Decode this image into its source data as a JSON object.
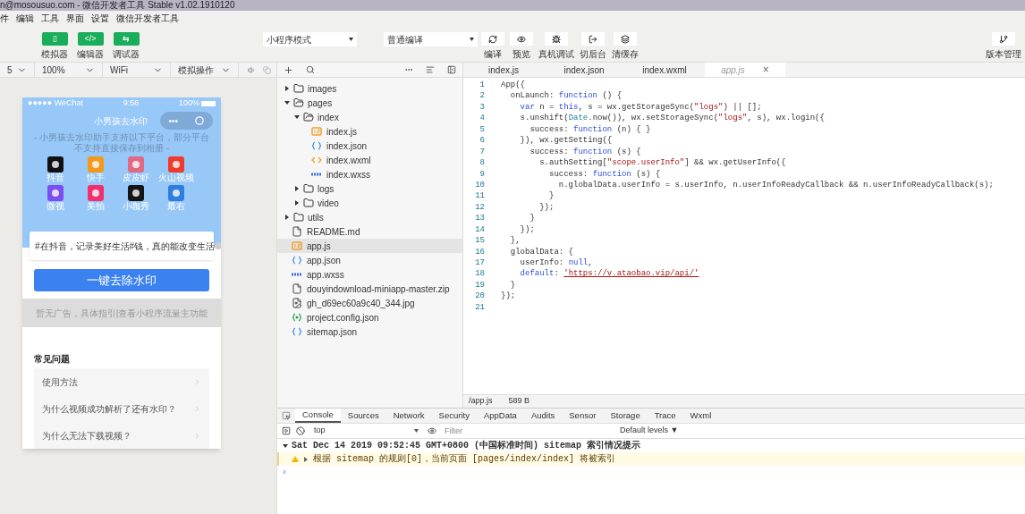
{
  "window": {
    "title": "n@mosousuo.com - 微信开发者工具 Stable v1.02.1910120"
  },
  "menu": [
    "件",
    "编辑",
    "工具",
    "界面",
    "设置",
    "微信开发者工具"
  ],
  "toolbar": {
    "toggles": [
      {
        "label": "模拟器",
        "glyph": "▯",
        "on": true
      },
      {
        "label": "编辑器",
        "glyph": "</>",
        "on": true
      },
      {
        "label": "调试器",
        "glyph": "⇆",
        "on": true
      }
    ],
    "mode_select": "小程序模式",
    "compile_select": "普通编译",
    "actions": [
      {
        "kind": "refresh",
        "label": "编译"
      },
      {
        "kind": "eye",
        "label": "预览"
      },
      {
        "kind": "bug",
        "label": "真机调试"
      },
      {
        "kind": "exit",
        "label": "切后台"
      },
      {
        "kind": "layers",
        "label": "清缓存"
      }
    ],
    "version": {
      "label": "版本管理"
    }
  },
  "simulator_bar": {
    "device": "5",
    "zoom": "100%",
    "network": "WiFi",
    "operation": "模拟操作"
  },
  "phone": {
    "carrier": "●●●●● WeChat",
    "time": "9:56",
    "battery": "100%",
    "title": "小男孩去水印",
    "capsule_more": "•••",
    "subtitle": "- 小男孩去水印助手支持以下平台，部分平台不支持直接保存到相册 -",
    "apps": [
      {
        "label": "抖音",
        "color": "#111111"
      },
      {
        "label": "快手",
        "color": "#f39a1c"
      },
      {
        "label": "皮皮虾",
        "color": "#e06a84"
      },
      {
        "label": "火山视频",
        "color": "#ee3b2c"
      },
      {
        "label": "微视",
        "color": "#7a4ef0"
      },
      {
        "label": "美拍",
        "color": "#f0306e"
      },
      {
        "label": "小咖秀",
        "color": "#151515"
      },
      {
        "label": "最右",
        "color": "#2f7de0"
      }
    ],
    "link_value": "#在抖音，记录美好生活#钱，真的能改变生活",
    "button": "一键去除水印",
    "ad": "暂无广告，具体指引|查看小程序流量主功能",
    "faq_title": "常见问题",
    "faq": [
      "使用方法",
      "为什么视频成功解析了还有水印？",
      "为什么无法下载视频？"
    ]
  },
  "tree": [
    {
      "kind": "folder",
      "name": "images",
      "expanded": false
    },
    {
      "kind": "folder",
      "name": "pages",
      "expanded": true,
      "children": [
        {
          "kind": "folder",
          "name": "index",
          "expanded": true,
          "children": [
            {
              "kind": "js",
              "name": "index.js",
              "selected": false
            },
            {
              "kind": "json",
              "name": "index.json",
              "selected": false
            },
            {
              "kind": "wxml",
              "name": "index.wxml",
              "selected": false
            },
            {
              "kind": "wxss",
              "name": "index.wxss",
              "selected": false
            }
          ]
        },
        {
          "kind": "folder",
          "name": "logs",
          "expanded": false
        },
        {
          "kind": "folder",
          "name": "video",
          "expanded": false
        }
      ]
    },
    {
      "kind": "folder",
      "name": "utils",
      "expanded": false
    },
    {
      "kind": "file",
      "name": "README.md",
      "selected": false
    },
    {
      "kind": "js",
      "name": "app.js",
      "selected": true
    },
    {
      "kind": "json",
      "name": "app.json",
      "selected": false
    },
    {
      "kind": "wxss",
      "name": "app.wxss",
      "selected": false
    },
    {
      "kind": "file",
      "name": "douyindownload-miniapp-master.zip",
      "selected": false
    },
    {
      "kind": "image",
      "name": "gh_d69ec60a9c40_344.jpg",
      "selected": false
    },
    {
      "kind": "config",
      "name": "project.config.json",
      "selected": false
    },
    {
      "kind": "json",
      "name": "sitemap.json",
      "selected": false
    }
  ],
  "editor": {
    "tabs": [
      {
        "label": "index.js",
        "selected": false
      },
      {
        "label": "index.json",
        "selected": false
      },
      {
        "label": "index.wxml",
        "selected": false
      },
      {
        "label": "app.js",
        "selected": true,
        "close": "×"
      }
    ],
    "lines": [
      {
        "n": "1",
        "tokens": [
          {
            "t": "App({",
            "kind": "plain"
          }
        ]
      },
      {
        "n": "2",
        "tokens": [
          {
            "t": "  onLaunch: ",
            "kind": "plain"
          },
          {
            "t": "function",
            "kind": "kw"
          },
          {
            "t": " () {",
            "kind": "plain"
          }
        ]
      },
      {
        "n": "3",
        "tokens": [
          {
            "t": "    var",
            "kind": "kw"
          },
          {
            "t": " n = ",
            "kind": "plain"
          },
          {
            "t": "this",
            "kind": "kw"
          },
          {
            "t": ", s = wx.getStorageSync(",
            "kind": "plain"
          },
          {
            "t": "\"logs\"",
            "kind": "str"
          },
          {
            "t": ") || [];",
            "kind": "plain"
          }
        ]
      },
      {
        "n": "4",
        "tokens": [
          {
            "t": "    s.unshift(",
            "kind": "plain"
          },
          {
            "t": "Date",
            "kind": "type"
          },
          {
            "t": ".now()), wx.setStorageSync(",
            "kind": "plain"
          },
          {
            "t": "\"logs\"",
            "kind": "str"
          },
          {
            "t": ", s), wx.login({",
            "kind": "plain"
          }
        ]
      },
      {
        "n": "5",
        "tokens": [
          {
            "t": "      success: ",
            "kind": "plain"
          },
          {
            "t": "function",
            "kind": "kw"
          },
          {
            "t": " (n) { }",
            "kind": "plain"
          }
        ]
      },
      {
        "n": "6",
        "tokens": [
          {
            "t": "    }), wx.getSetting({",
            "kind": "plain"
          }
        ]
      },
      {
        "n": "7",
        "tokens": [
          {
            "t": "      success: ",
            "kind": "plain"
          },
          {
            "t": "function",
            "kind": "kw"
          },
          {
            "t": " (s) {",
            "kind": "plain"
          }
        ]
      },
      {
        "n": "8",
        "tokens": [
          {
            "t": "        s.authSetting[",
            "kind": "plain"
          },
          {
            "t": "\"scope.userInfo\"",
            "kind": "str"
          },
          {
            "t": "] && wx.getUserInfo({",
            "kind": "plain"
          }
        ]
      },
      {
        "n": "9",
        "tokens": [
          {
            "t": "          success: ",
            "kind": "plain"
          },
          {
            "t": "function",
            "kind": "kw"
          },
          {
            "t": " (s) {",
            "kind": "plain"
          }
        ]
      },
      {
        "n": "10",
        "tokens": [
          {
            "t": "            n.globalData.userInfo = s.userInfo, n.userInfoReadyCallback && n.userInfoReadyCallback(s);",
            "kind": "plain"
          }
        ]
      },
      {
        "n": "11",
        "tokens": [
          {
            "t": "          }",
            "kind": "plain"
          }
        ]
      },
      {
        "n": "12",
        "tokens": [
          {
            "t": "        });",
            "kind": "plain"
          }
        ]
      },
      {
        "n": "13",
        "tokens": [
          {
            "t": "      }",
            "kind": "plain"
          }
        ]
      },
      {
        "n": "14",
        "tokens": [
          {
            "t": "    });",
            "kind": "plain"
          }
        ]
      },
      {
        "n": "15",
        "tokens": [
          {
            "t": "  },",
            "kind": "plain"
          }
        ]
      },
      {
        "n": "16",
        "tokens": [
          {
            "t": "  globalData: {",
            "kind": "plain"
          }
        ]
      },
      {
        "n": "17",
        "tokens": [
          {
            "t": "    userInfo: ",
            "kind": "plain"
          },
          {
            "t": "null",
            "kind": "kw"
          },
          {
            "t": ",",
            "kind": "plain"
          }
        ]
      },
      {
        "n": "18",
        "tokens": [
          {
            "t": "    default",
            "kind": "kw"
          },
          {
            "t": ": ",
            "kind": "plain"
          },
          {
            "t": "'https://v.ataobao.vip/api/'",
            "kind": "link"
          }
        ]
      },
      {
        "n": "19",
        "tokens": [
          {
            "t": "  }",
            "kind": "plain"
          }
        ]
      },
      {
        "n": "20",
        "tokens": [
          {
            "t": "});",
            "kind": "plain"
          }
        ]
      },
      {
        "n": "21"
      }
    ]
  },
  "status_bar": {
    "path": "/app.js",
    "size": "589 B"
  },
  "devtools": {
    "tabs": [
      {
        "label": "Console",
        "selected": true
      },
      {
        "label": "Sources",
        "selected": false
      },
      {
        "label": "Network",
        "selected": false
      },
      {
        "label": "Security",
        "selected": false
      },
      {
        "label": "AppData",
        "selected": false
      },
      {
        "label": "Audits",
        "selected": false
      },
      {
        "label": "Sensor",
        "selected": false
      },
      {
        "label": "Storage",
        "selected": false
      },
      {
        "label": "Trace",
        "selected": false
      },
      {
        "label": "Wxml",
        "selected": false
      }
    ],
    "context": "top",
    "filter_placeholder": "Filter",
    "levels": "Default levels ▼",
    "messages": [
      {
        "kind": "group",
        "text": "Sat Dec 14 2019 09:52:45 GMT+0800 (中国标准时间) sitemap 索引情况提示",
        "expanded": true
      },
      {
        "kind": "warning",
        "text": "根据 sitemap 的规则[0]，当前页面 [pages/index/index] 将被索引"
      }
    ],
    "prompt": "›"
  }
}
